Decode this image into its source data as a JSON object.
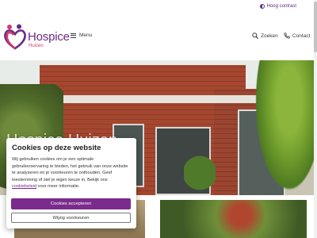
{
  "topbar": {
    "contrast_label": "Hoog contrast"
  },
  "logo": {
    "name": "Hospice",
    "subtitle": "Huizen"
  },
  "header": {
    "menu_label": "Menu",
    "search_label": "Zoeken",
    "contact_label": "Contact"
  },
  "hero": {
    "title": "Hospice Huizen"
  },
  "cookie_banner": {
    "title": "Cookies op deze website",
    "text_before_link": "Wij gebruiken cookies om je een optimale gebruikerservaring te bieden, het gebruik van onze website te analyseren en je voorkeuren te onthouden. Geef toestemming of stel je eigen keuze in. Bekijk ons ",
    "link_label": "cookiebeleid",
    "text_after_link": " voor meer informatie.",
    "accept_label": "Cookies accepteren",
    "preferences_label": "Wijzig voorkeuren"
  },
  "colors": {
    "brand_purple": "#7a2b8c",
    "brand_pink": "#d23b6a",
    "logo_purple": "#6b2a86"
  },
  "icons": [
    "contrast-icon",
    "logo-hearts-icon",
    "hamburger-icon",
    "search-icon",
    "phone-icon"
  ]
}
